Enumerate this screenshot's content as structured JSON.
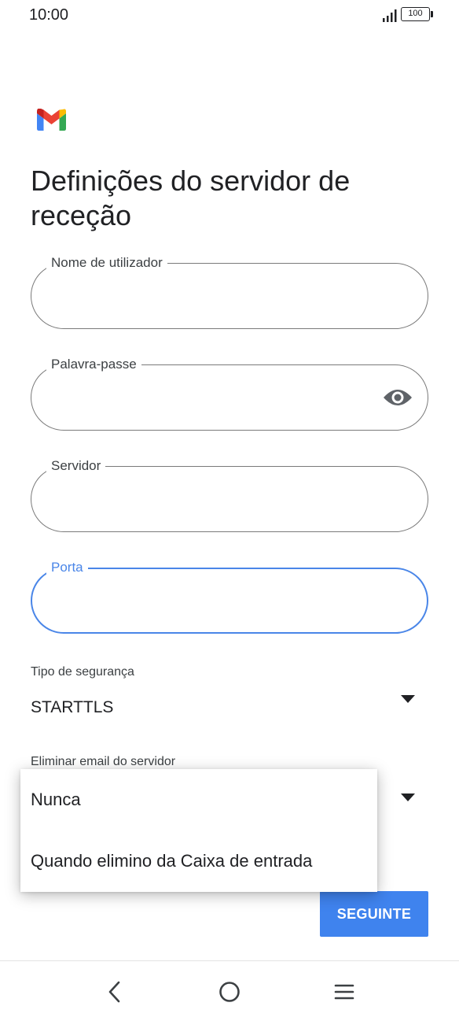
{
  "status_bar": {
    "time": "10:00",
    "signal_icon": "signal-bars-icon",
    "battery_level": "100"
  },
  "app": {
    "logo": "gmail-logo",
    "colors": {
      "red": "#EA4335",
      "blue": "#4285F4",
      "green": "#34A853",
      "yellow": "#FBBC04"
    }
  },
  "title": "Definições do servidor de receção",
  "fields": {
    "username": {
      "label": "Nome de utilizador",
      "value": ""
    },
    "password": {
      "label": "Palavra-passe",
      "value": "",
      "toggle_icon": "eye-icon"
    },
    "server": {
      "label": "Servidor",
      "value": ""
    },
    "port": {
      "label": "Porta",
      "value": "",
      "focused": true
    }
  },
  "security": {
    "label": "Tipo de segurança",
    "value": "STARTTLS"
  },
  "delete_email": {
    "label": "Eliminar email do servidor",
    "options": [
      "Nunca",
      "Quando elimino da Caixa de entrada"
    ]
  },
  "next_button": "SEGUINTE",
  "nav": {
    "back": "back-icon",
    "home": "home-icon",
    "recents": "recents-icon"
  },
  "accent_color": "#4A86E8",
  "button_color": "#3F83EE"
}
